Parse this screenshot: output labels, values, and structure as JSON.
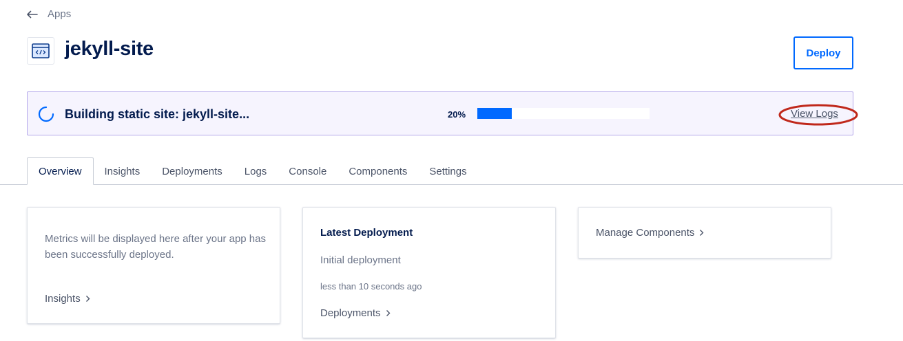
{
  "nav": {
    "back_label": "Apps"
  },
  "app": {
    "title": "jekyll-site"
  },
  "header": {
    "deploy_label": "Deploy"
  },
  "banner": {
    "status_text": "Building static site: jekyll-site...",
    "progress_label": "20%",
    "progress_fraction": 0.2,
    "view_logs_label": "View Logs"
  },
  "tabs": [
    {
      "label": "Overview",
      "active": true
    },
    {
      "label": "Insights"
    },
    {
      "label": "Deployments"
    },
    {
      "label": "Logs"
    },
    {
      "label": "Console"
    },
    {
      "label": "Components"
    },
    {
      "label": "Settings"
    }
  ],
  "cards": {
    "metrics": {
      "text": "Metrics will be displayed here after your app has been successfully deployed.",
      "link_label": "Insights"
    },
    "latest_deployment": {
      "title": "Latest Deployment",
      "subtitle": "Initial deployment",
      "time": "less than 10 seconds ago",
      "link_label": "Deployments"
    },
    "components": {
      "link_label": "Manage Components"
    }
  },
  "colors": {
    "accent": "#0069ff",
    "text_dark": "#031b4e",
    "banner_bg": "#f6f4fe",
    "banner_border": "#b4a8ea",
    "annotation": "#c0281b"
  },
  "icons": [
    "arrow-left-icon",
    "code-window-icon",
    "loading-spinner-icon",
    "chevron-right-icon"
  ]
}
